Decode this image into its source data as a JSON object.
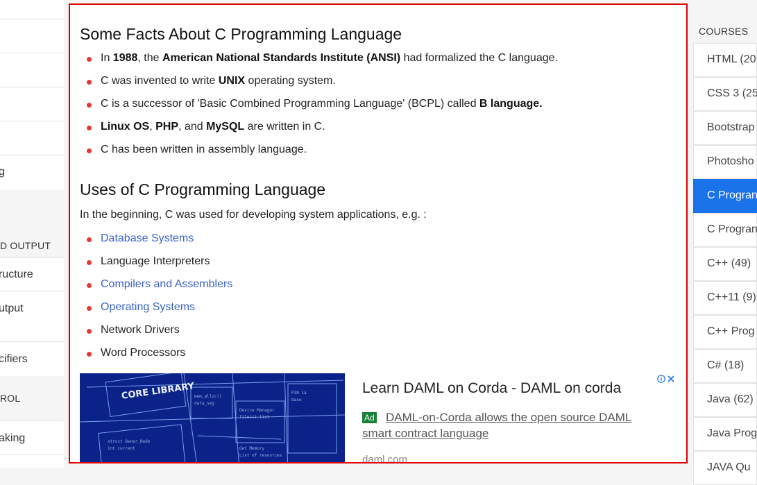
{
  "left_sidebar": {
    "items_top": [
      "",
      "",
      "",
      "",
      "",
      "g"
    ],
    "section_io": "D OUTPUT",
    "items_io": [
      "ructure",
      "utput",
      "cifiers"
    ],
    "section_control": "ROL",
    "items_control": [
      "aking",
      ""
    ]
  },
  "main": {
    "facts": {
      "heading": "Some Facts About C Programming Language",
      "items": [
        [
          {
            "t": "In "
          },
          {
            "t": "1988",
            "b": true
          },
          {
            "t": ", the "
          },
          {
            "t": "American National Standards Institute (ANSI)",
            "b": true
          },
          {
            "t": " had formalized the C language."
          }
        ],
        [
          {
            "t": "C was invented to write "
          },
          {
            "t": "UNIX",
            "b": true
          },
          {
            "t": " operating system."
          }
        ],
        [
          {
            "t": "C is a successor of 'Basic Combined Programming Language' (BCPL) called "
          },
          {
            "t": "B language.",
            "b": true
          }
        ],
        [
          {
            "t": "Linux OS",
            "b": true
          },
          {
            "t": ", "
          },
          {
            "t": "PHP",
            "b": true
          },
          {
            "t": ", and "
          },
          {
            "t": "MySQL",
            "b": true
          },
          {
            "t": " are written in C."
          }
        ],
        [
          {
            "t": "C has been written in assembly language."
          }
        ]
      ]
    },
    "uses": {
      "heading": "Uses of C Programming Language",
      "intro": "In the beginning, C was used for developing system applications, e.g. :",
      "items": [
        {
          "label": "Database Systems",
          "link": true
        },
        {
          "label": "Language Interpreters",
          "link": false
        },
        {
          "label": "Compilers and Assemblers",
          "link": true
        },
        {
          "label": "Operating Systems",
          "link": true
        },
        {
          "label": "Network Drivers",
          "link": false
        },
        {
          "label": "Word Processors",
          "link": false
        }
      ]
    },
    "ad": {
      "image_text": "CORE LIBRARY",
      "title": "Learn DAML on Corda - DAML on corda",
      "badge": "Ad",
      "description": "DAML-on-Corda allows the open source DAML smart contract language",
      "url": "daml.com",
      "info_icon": "info-icon",
      "close_icon": "close-icon"
    }
  },
  "right_sidebar": {
    "heading": "COURSES",
    "items": [
      {
        "label": "HTML (20",
        "active": false
      },
      {
        "label": "CSS 3 (25",
        "active": false
      },
      {
        "label": "Bootstrap",
        "active": false
      },
      {
        "label": "Photosho",
        "active": false
      },
      {
        "label": "C Progran",
        "active": true
      },
      {
        "label": "C Progran",
        "active": false
      },
      {
        "label": "C++ (49)",
        "active": false
      },
      {
        "label": "C++11 (9)",
        "active": false
      },
      {
        "label": "C++ Prog",
        "active": false
      },
      {
        "label": "C# (18)",
        "active": false
      },
      {
        "label": "Java (62)",
        "active": false
      },
      {
        "label": "Java Prog",
        "active": false
      },
      {
        "label": "JAVA Qu",
        "active": false
      }
    ]
  },
  "colors": {
    "accent": "#1a73e8",
    "bullet": "#e53935",
    "link": "#3a63c8",
    "highlight_border": "#e00000",
    "ad_badge": "#188038"
  }
}
